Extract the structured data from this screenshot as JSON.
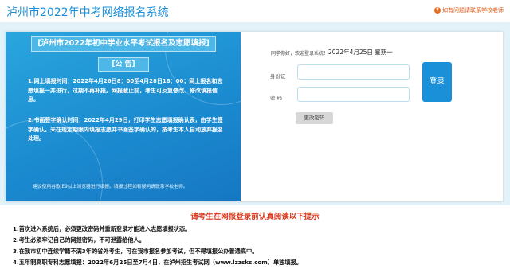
{
  "header": {
    "site_title": "泸州市2022年中考网络报名系统",
    "help_link": "如有问题请联系学校老师"
  },
  "notice": {
    "heading": "[泸州市2022年初中学业水平考试报名及志愿填报]",
    "subheading": "[公    告]",
    "paragraph1": "1.网上填报时间：2022年4月26日8：00至4月28日18：00；网上报名和志愿填报一并进行，过期不再补报。网报截止前，考生可反复修改、修改填报信息。",
    "paragraph2": "2.书面签字确认时间：2022年4月29日，打印学生志愿填报确认表，由学生签字确认。未在规定期限内填报志愿并书面签字确认的，按考生本人自动放弃报名处理。",
    "footer": "建议使用谷歌IE9以上浏览器进行填报。填报过程如有疑问请联系学校老师。"
  },
  "login": {
    "greeting": "同学你好，欢迎登录系统！",
    "date": "2022年4月25日    星期一",
    "id_label": "身份证",
    "password_label": "密    码",
    "id_value": "",
    "password_value": "",
    "login_button": "登录",
    "change_password_button": "更改密码"
  },
  "tips": {
    "title": "请考生在网报登录前认真阅读以下提示",
    "items": [
      "1.首次进入系统后，必须更改密码并重新登录才能进入志愿填报状态。",
      "2.考生必须牢记自己的网报密码，不可泄露给他人。",
      "3.在我市初中连续学籍不满3年的省外考生，可在我市报名参加考试，但不得填报公办普通高中。",
      "4.五年制高职专科志愿填报：2022年6月25日至7月4日，在泸州招生考试网（www.lzzsks.com）单独填报。"
    ]
  },
  "colors": {
    "brand_blue": "#1a90d8",
    "tips_red": "#d9381e",
    "help_orange": "#e05a16"
  }
}
